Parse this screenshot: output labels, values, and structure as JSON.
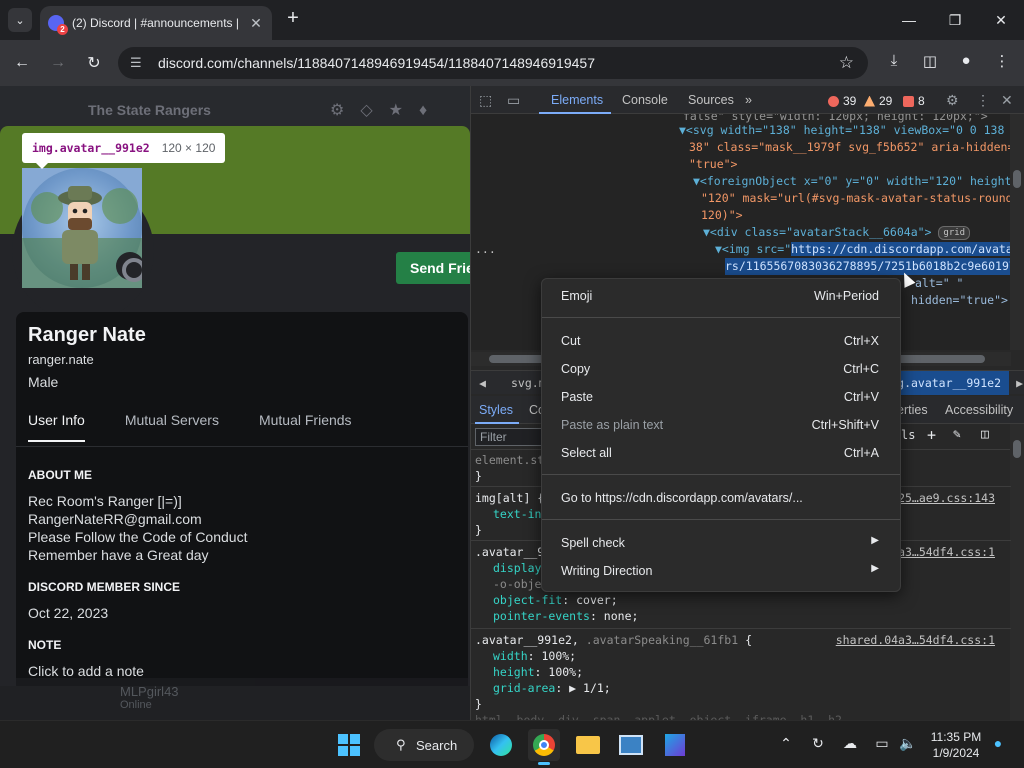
{
  "browser": {
    "tab": {
      "badge": "2",
      "title": "(2) Discord | #announcements |"
    },
    "url": "discord.com/channels/1188407148946919454/1188407148946919457"
  },
  "discord": {
    "server_name": "The State Rangers",
    "tooltip": {
      "selector": "img.avatar__991e2",
      "dims": "120 × 120"
    },
    "send_friend_label": "Send Frie",
    "profile": {
      "display_name": "Ranger Nate",
      "username": "ranger.nate",
      "pronouns": "Male",
      "tabs": [
        "User Info",
        "Mutual Servers",
        "Mutual Friends"
      ],
      "about_me_heading": "ABOUT ME",
      "about_me_lines": [
        "Rec Room's Ranger [|=)]",
        "RangerNateRR@gmail.com",
        "Please Follow the Code of Conduct",
        "Remember have a Great day"
      ],
      "member_since_heading": "DISCORD MEMBER SINCE",
      "member_since": "Oct 22, 2023",
      "note_heading": "NOTE",
      "note_placeholder": "Click to add a note"
    },
    "bottom_user": {
      "name": "MLPgirl43",
      "status": "Online"
    }
  },
  "devtools": {
    "tabs": [
      "Elements",
      "Console",
      "Sources"
    ],
    "errors": "39",
    "warnings": "29",
    "issues": "8",
    "elements_lines": [
      "false\" style=\"width: 120px; height: 120px;\">",
      "▼<svg width=\"138\" height=\"138\" viewBox=\"0 0 138 1",
      "38\" class=\"mask__1979f svg_f5b652\" aria-hidden=",
      "\"true\">",
      "▼<foreignObject x=\"0\" y=\"0\" width=\"120\" height=",
      "\"120\" mask=\"url(#svg-mask-avatar-status-round-",
      "120)\">",
      "▼<div class=\"avatarStack__6604a\">",
      "▼<img src=\"",
      "https://cdn.discordapp.com/avata",
      "rs/1165567083036278895/7251b6018b2c9e60197",
      "alt=\" \"",
      "hidden=\"true\">"
    ],
    "grid_badge": "grid",
    "ellipsis": "...",
    "breadcrumbs": {
      "first": "svg.m",
      "active": "img.avatar__991e2"
    },
    "styles_tabs": [
      "Styles",
      "Co",
      "erties",
      "Accessibility"
    ],
    "filter_placeholder": "Filter",
    "styles_lines": {
      "element_style": "element.st",
      "close": "}",
      "rule1_selector": "img[alt] {",
      "rule1_prop": "text-ind",
      "rule1_src": "6225…ae9.css:143",
      "rule2_selector": ".avatar__9",
      "rule2_prop1": "display",
      "rule2_prop2": "-o-object",
      "rule2_prop3_name": "object-fit",
      "rule2_prop3_val": "cover;",
      "rule2_prop4_name": "pointer-events",
      "rule2_prop4_val": "none;",
      "rule2_src": "04a3…54df4.css:1",
      "rule3_selector_a": ".avatar__991e2,",
      "rule3_selector_b": ".avatarSpeaking__61fb1",
      "rule3_open": "{",
      "rule3_src": "shared.04a3…54df4.css:1",
      "rule3_width_name": "width",
      "rule3_width_val": "100%;",
      "rule3_height_name": "height",
      "rule3_height_val": "100%;",
      "rule3_grid_name": "grid-area",
      "rule3_grid_val": "▶ 1/1;",
      "bottom_line": "html, body, div, span, applet, object, iframe, h1, h2,",
      "bottom_src": "app.cec6225.7ae9.css:30"
    },
    "styles_toolbar_label": "ls"
  },
  "context_menu": {
    "emoji": {
      "label": "Emoji",
      "accel": "Win+Period"
    },
    "cut": {
      "label": "Cut",
      "accel": "Ctrl+X"
    },
    "copy": {
      "label": "Copy",
      "accel": "Ctrl+C"
    },
    "paste": {
      "label": "Paste",
      "accel": "Ctrl+V"
    },
    "paste_plain": {
      "label": "Paste as plain text",
      "accel": "Ctrl+Shift+V"
    },
    "select_all": {
      "label": "Select all",
      "accel": "Ctrl+A"
    },
    "go_to": {
      "label": "Go to https://cdn.discordapp.com/avatars/..."
    },
    "spell_check": {
      "label": "Spell check"
    },
    "writing_direction": {
      "label": "Writing Direction"
    }
  },
  "taskbar": {
    "search_label": "Search",
    "time": "11:35 PM",
    "date": "1/9/2024"
  }
}
